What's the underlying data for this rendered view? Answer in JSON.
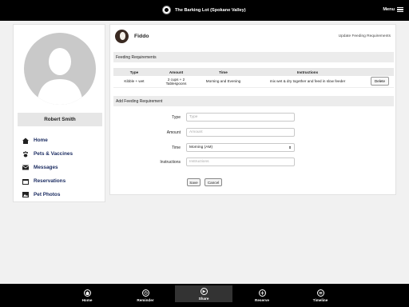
{
  "header": {
    "title": "The Barking Lot (Spokane Valley)",
    "menu_label": "Menu"
  },
  "sidebar": {
    "user_name": "Robert Smith",
    "items": [
      {
        "label": "Home",
        "icon": "home-icon"
      },
      {
        "label": "Pets & Vaccines",
        "icon": "paw-icon"
      },
      {
        "label": "Messages",
        "icon": "envelope-icon"
      },
      {
        "label": "Reservations",
        "icon": "calendar-icon"
      },
      {
        "label": "Pet Photos",
        "icon": "photo-icon"
      }
    ]
  },
  "pet": {
    "name": "Fiddo",
    "update_link": "Update Feeding Requirements"
  },
  "feeding": {
    "section_title": "Feeding Requirements",
    "columns": [
      "Type",
      "Amount",
      "Time",
      "Instructions"
    ],
    "rows": [
      {
        "type": "Kibble + wet",
        "amount_line1": "2 cups + 2",
        "amount_line2": "Tablespoons",
        "time": "Morning and Evening",
        "instructions": "mix wet & dry together and feed in slow feeder",
        "action": "Delete"
      }
    ]
  },
  "add_form": {
    "section_title": "Add Feeding Requirement",
    "fields": {
      "type": {
        "label": "Type",
        "placeholder": "Type"
      },
      "amount": {
        "label": "Amount",
        "placeholder": "Amount"
      },
      "time": {
        "label": "Time",
        "value": "Morning (AM)"
      },
      "instructions": {
        "label": "Instructions",
        "placeholder": "Instructions"
      }
    },
    "save_label": "Save",
    "cancel_label": "Cancel"
  },
  "bottom_nav": [
    {
      "label": "Home",
      "icon": "home-icon"
    },
    {
      "label": "Reminder",
      "icon": "reminder-icon"
    },
    {
      "label": "Share",
      "icon": "share-icon",
      "active": true
    },
    {
      "label": "Reserve",
      "icon": "plus-icon"
    },
    {
      "label": "Timeline",
      "icon": "timeline-icon"
    }
  ]
}
